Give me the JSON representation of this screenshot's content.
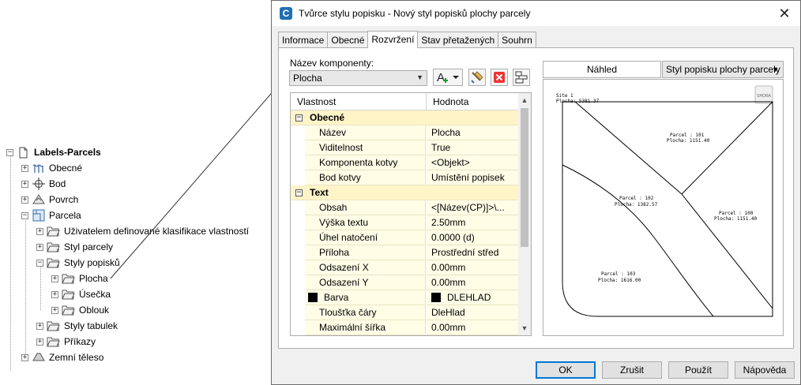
{
  "tree": {
    "root": "Labels-Parcels",
    "items": [
      {
        "label": "Obecné",
        "icon": "general-icon"
      },
      {
        "label": "Bod",
        "icon": "point-icon"
      },
      {
        "label": "Povrch",
        "icon": "surface-icon"
      },
      {
        "label": "Parcela",
        "icon": "parcel-icon"
      },
      {
        "label": "Uživatelem definované klasifikace vlastností",
        "icon": "folder-icon"
      },
      {
        "label": "Styl parcely",
        "icon": "folder-icon"
      },
      {
        "label": "Styly popisků",
        "icon": "folder-icon"
      },
      {
        "label": "Plocha",
        "icon": "folder-icon"
      },
      {
        "label": "Úsečka",
        "icon": "folder-icon"
      },
      {
        "label": "Oblouk",
        "icon": "folder-icon"
      },
      {
        "label": "Styly tabulek",
        "icon": "folder-icon"
      },
      {
        "label": "Příkazy",
        "icon": "folder-icon"
      },
      {
        "label": "Zemní těleso",
        "icon": "corridor-icon"
      }
    ]
  },
  "dialog": {
    "title": "Tvůrce stylu popisku - Nový styl popisků plochy parcely",
    "app_icon_letter": "C",
    "tabs": [
      "Informace",
      "Obecné",
      "Rozvržení",
      "Stav přetažených",
      "Souhrn"
    ],
    "active_tab": "Rozvržení",
    "component_name_label": "Název komponenty:",
    "component_value": "Plocha",
    "grid_headers": {
      "property": "Vlastnost",
      "value": "Hodnota"
    },
    "categories": [
      {
        "name": "Obecné",
        "rows": [
          {
            "name": "Název",
            "value": "Plocha"
          },
          {
            "name": "Viditelnost",
            "value": "True"
          },
          {
            "name": "Komponenta kotvy",
            "value": "<Objekt>"
          },
          {
            "name": "Bod kotvy",
            "value": "Umístění popisek"
          }
        ]
      },
      {
        "name": "Text",
        "rows": [
          {
            "name": "Obsah",
            "value": "<[Název(CP)]>\\..."
          },
          {
            "name": "Výška textu",
            "value": "2.50mm"
          },
          {
            "name": "Úhel natočení",
            "value": "0.0000 (d)"
          },
          {
            "name": "Příloha",
            "value": "Prostřední střed"
          },
          {
            "name": "Odsazení X",
            "value": "0.00mm"
          },
          {
            "name": "Odsazení Y",
            "value": "0.00mm"
          },
          {
            "name": "Barva",
            "value": "DLEHLAD"
          },
          {
            "name": "Tloušťka čáry",
            "value": "DleHlad"
          },
          {
            "name": "Maximální šířka",
            "value": "0.00mm"
          }
        ]
      }
    ],
    "preview_label": "Náhled",
    "preview_style": "Styl popisku plochy parcely",
    "preview_cube_label": "SHORA",
    "preview_texts": {
      "site_line1": "Site 1",
      "site_line2": "Plocha: 5381.37",
      "p101_line1": "Parcel : 101",
      "p101_line2": "Plocha: 1151.40",
      "p102_line1": "Parcel : 102",
      "p102_line2": "Plocha: 1382.57",
      "p100_line1": "Parcel : 100",
      "p100_line2": "Plocha: 1151.40",
      "p103_line1": "Parcel : 103",
      "p103_line2": "Plocha: 1616.00"
    },
    "buttons": {
      "ok": "OK",
      "cancel": "Zrušit",
      "apply": "Použít",
      "help": "Nápověda"
    },
    "color_swatch": "#000000"
  }
}
